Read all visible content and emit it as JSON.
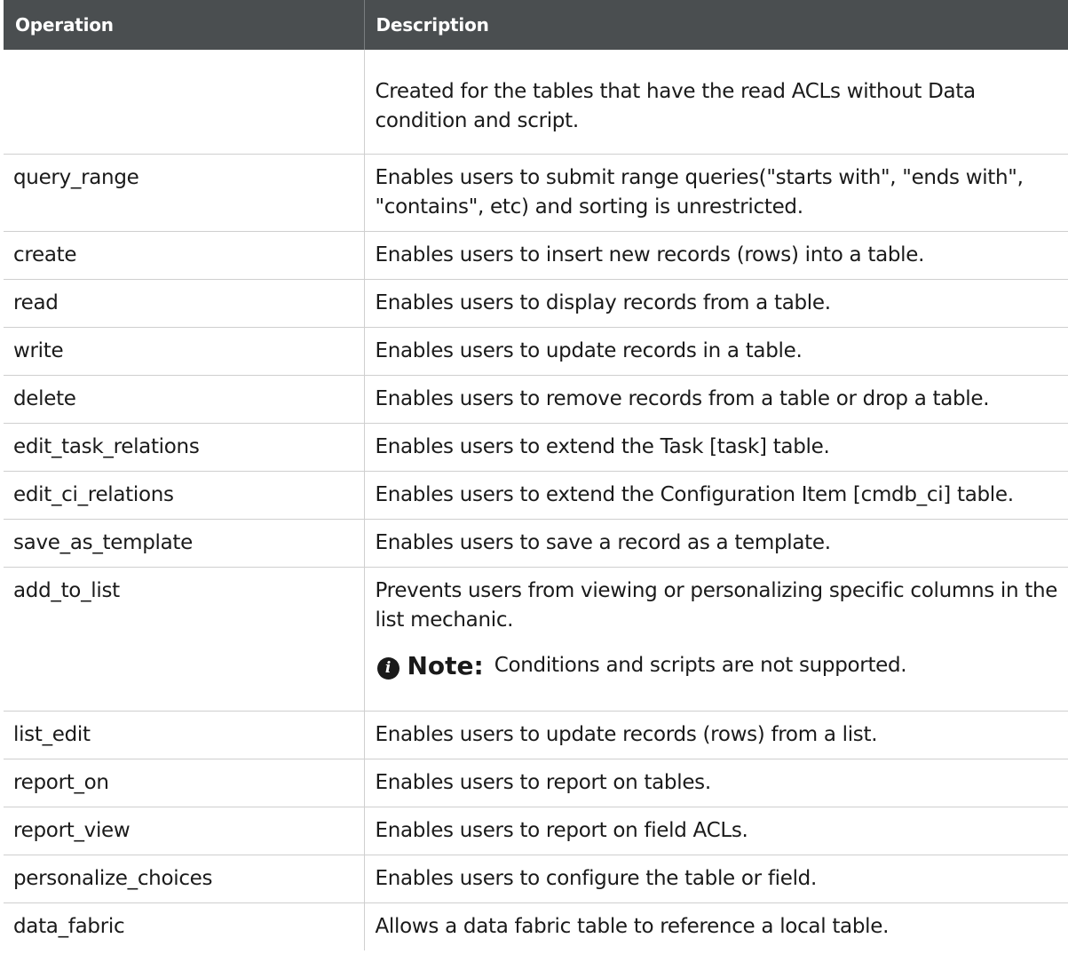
{
  "table": {
    "headers": [
      "Operation",
      "Description"
    ],
    "rows": [
      {
        "operation": "",
        "description": "Created for the tables that have the read ACLs without Data condition and script."
      },
      {
        "operation": "query_range",
        "description": "Enables users to submit range queries(\"starts with\", \"ends with\", \"contains\", etc) and sorting is unrestricted."
      },
      {
        "operation": "create",
        "description": "Enables users to insert new records (rows) into a table."
      },
      {
        "operation": "read",
        "description": "Enables users to display records from a table."
      },
      {
        "operation": "write",
        "description": "Enables users to update records in a table."
      },
      {
        "operation": "delete",
        "description": "Enables users to remove records from a table or drop a table."
      },
      {
        "operation": "edit_task_relations",
        "description": "Enables users to extend the Task [task] table."
      },
      {
        "operation": "edit_ci_relations",
        "description": "Enables users to extend the Configuration Item [cmdb_ci] table."
      },
      {
        "operation": "save_as_template",
        "description": "Enables users to save a record as a template."
      },
      {
        "operation": "add_to_list",
        "description": "Prevents users from viewing or personalizing specific columns in the list mechanic.",
        "note_label": "Note:",
        "note_text": "Conditions and scripts are not supported.",
        "note_icon": "info-icon"
      },
      {
        "operation": "list_edit",
        "description": "Enables users to update records (rows) from a list."
      },
      {
        "operation": "report_on",
        "description": "Enables users to report on tables."
      },
      {
        "operation": "report_view",
        "description": "Enables users to report on field ACLs."
      },
      {
        "operation": "personalize_choices",
        "description": "Enables users to configure the table or field."
      },
      {
        "operation": "data_fabric",
        "description": "Allows a data fabric table to reference a local table."
      }
    ]
  },
  "colors": {
    "header_bg": "#4a4e50",
    "header_text": "#ffffff",
    "border": "#cfcfcf",
    "text": "#1a1a1a"
  }
}
